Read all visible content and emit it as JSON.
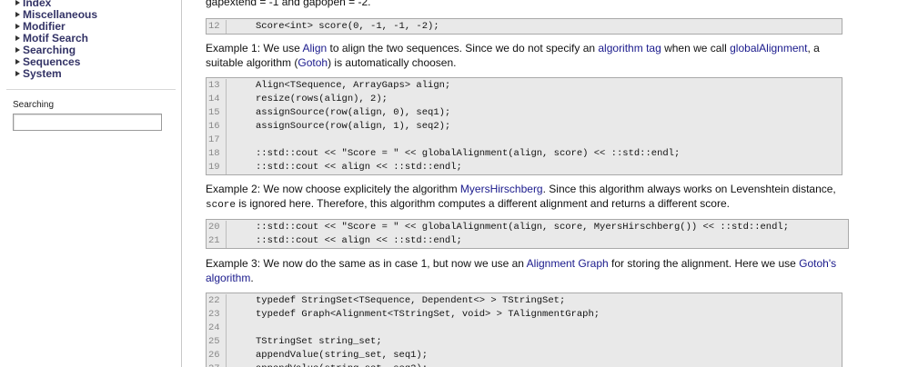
{
  "sidebar": {
    "nav": [
      "Index",
      "Miscellaneous",
      "Modifier",
      "Motif Search",
      "Searching",
      "Sequences",
      "System"
    ],
    "search_label": "Searching",
    "search_value": ""
  },
  "content": {
    "top_line": "gapextend = -1 and gapopen = -2.",
    "code1": [
      {
        "n": "12",
        "t": "Score<int> score(0, -1, -1, -2);"
      }
    ],
    "ex1": {
      "t1": "Example 1: We use ",
      "l1": "Align",
      "t2": " to align the two sequences. Since we do not specify an ",
      "l2": "algorithm tag",
      "t3": " when we call ",
      "l3": "globalAlignment",
      "t4": ", a suitable algorithm (",
      "l4": "Gotoh",
      "t5": ") is automatically choosen."
    },
    "code2": [
      {
        "n": "13",
        "t": "Align<TSequence, ArrayGaps> align;"
      },
      {
        "n": "14",
        "t": "resize(rows(align), 2);"
      },
      {
        "n": "15",
        "t": "assignSource(row(align, 0), seq1);"
      },
      {
        "n": "16",
        "t": "assignSource(row(align, 1), seq2);"
      },
      {
        "n": "17",
        "t": ""
      },
      {
        "n": "18",
        "t": "::std::cout << \"Score = \" << globalAlignment(align, score) << ::std::endl;"
      },
      {
        "n": "19",
        "t": "::std::cout << align << ::std::endl;"
      }
    ],
    "ex2": {
      "t1": "Example 2: We now choose explicitely the algorithm ",
      "l1": "MyersHirschberg",
      "t2": ". Since this algorithm always works on Levenshtein distance, ",
      "c1": "score",
      "t3": " is ignored here. Therefore, this algorithm computes a different alignment and returns a different score."
    },
    "code3": [
      {
        "n": "20",
        "t": "::std::cout << \"Score = \" << globalAlignment(align, score, MyersHirschberg()) << ::std::endl;"
      },
      {
        "n": "21",
        "t": "::std::cout << align << ::std::endl;"
      }
    ],
    "ex3": {
      "t1": "Example 3: We now do the same as in case 1, but now we use an ",
      "l1": "Alignment Graph",
      "t2": " for storing the alignment. Here we use ",
      "l2": "Gotoh's algorithm",
      "t3": "."
    },
    "code4": [
      {
        "n": "22",
        "t": "typedef StringSet<TSequence, Dependent<> > TStringSet;"
      },
      {
        "n": "23",
        "t": "typedef Graph<Alignment<TStringSet, void> > TAlignmentGraph;"
      },
      {
        "n": "24",
        "t": ""
      },
      {
        "n": "25",
        "t": "TStringSet string_set;"
      },
      {
        "n": "26",
        "t": "appendValue(string_set, seq1);"
      },
      {
        "n": "27",
        "t": "appendValue(string_set, seq2);"
      }
    ]
  }
}
